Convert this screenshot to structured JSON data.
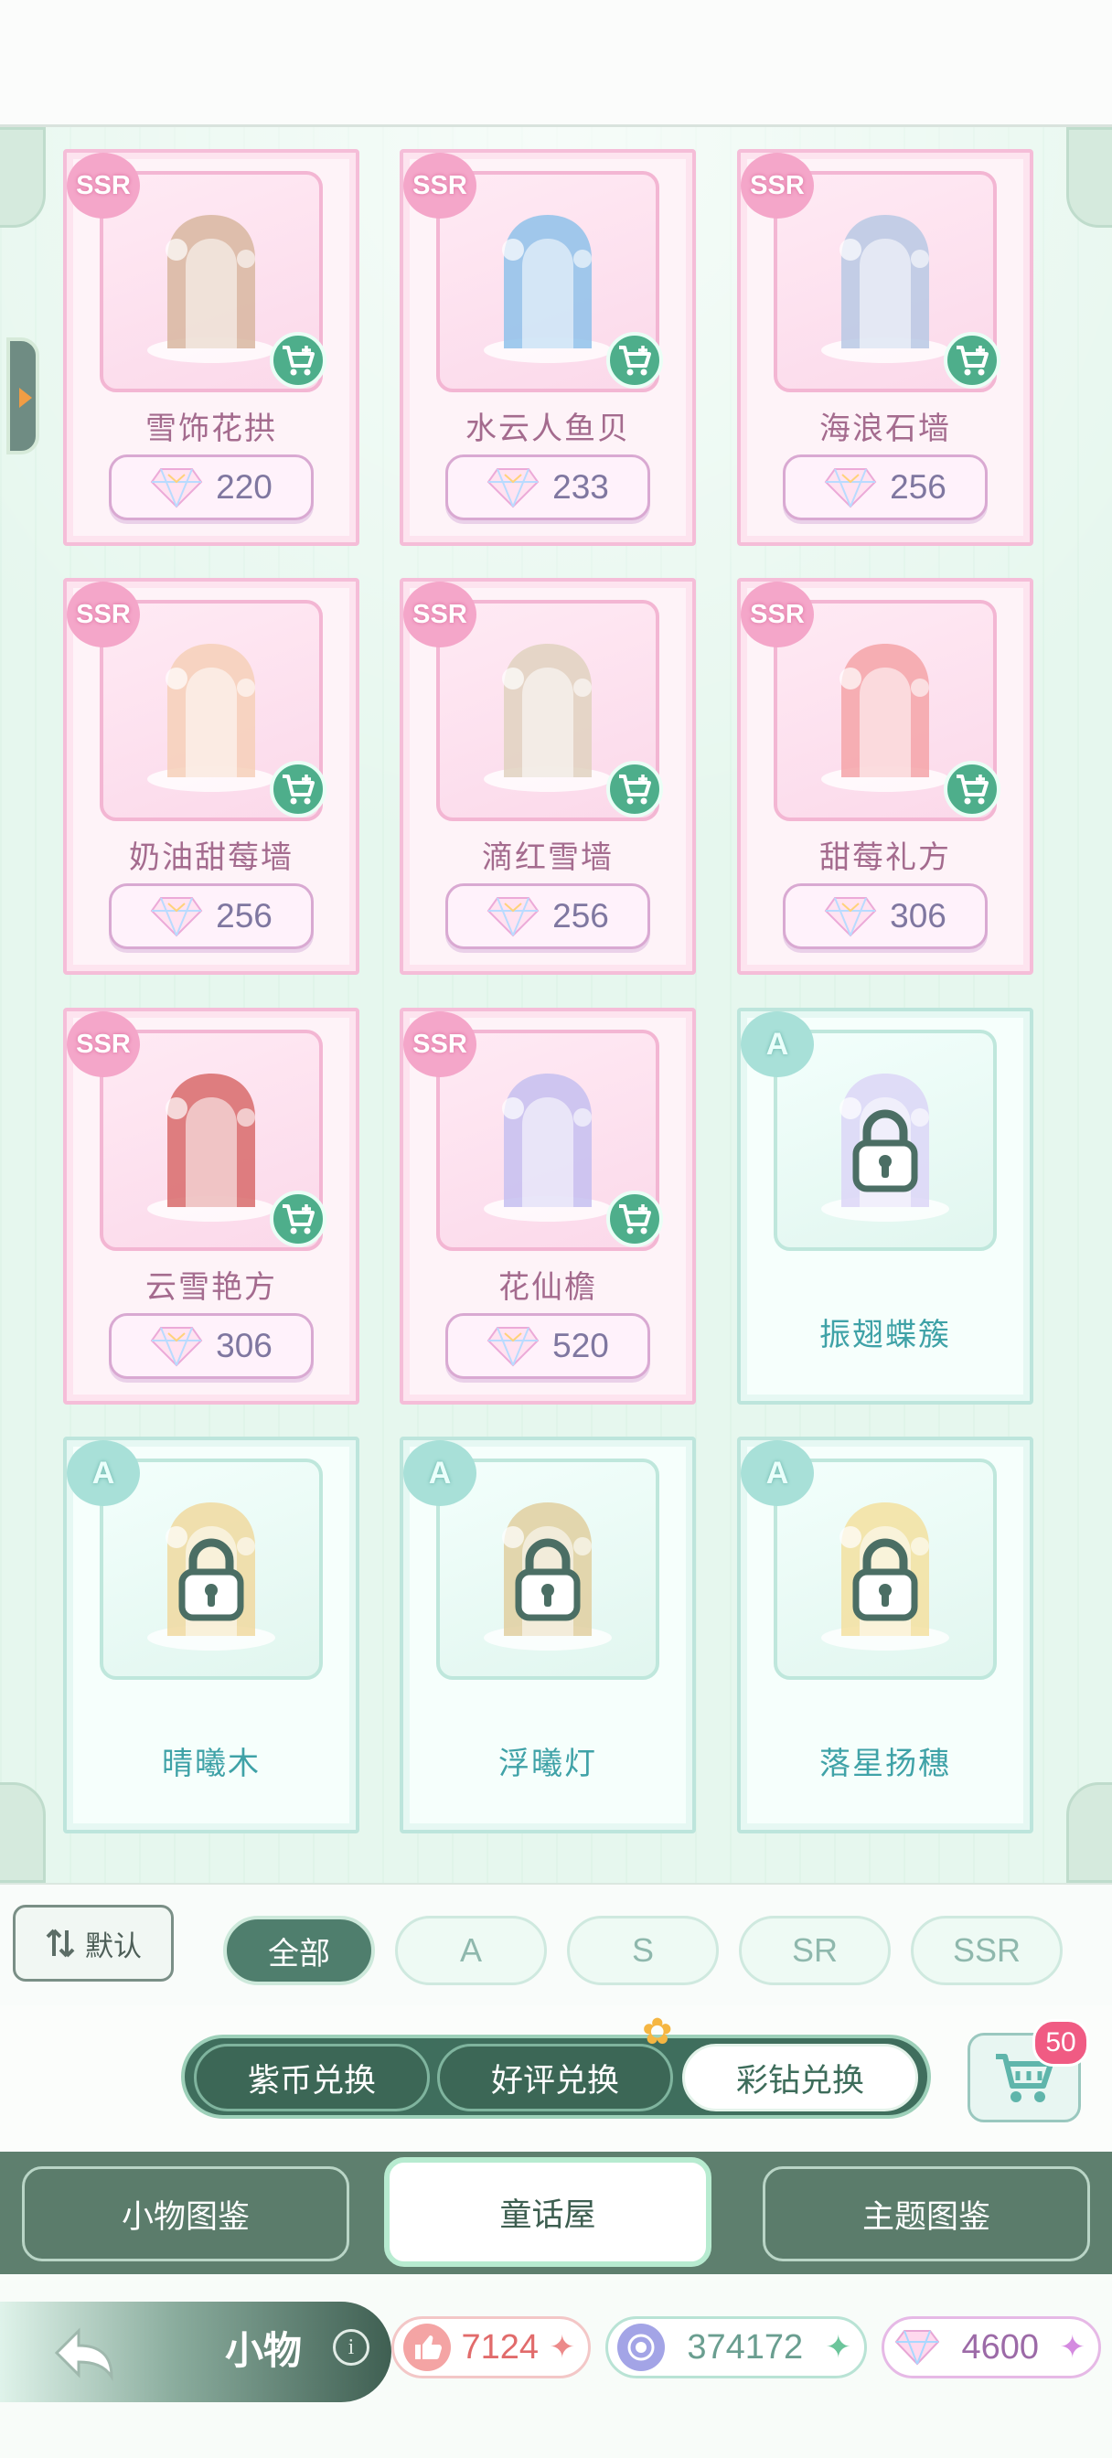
{
  "colors": {
    "ssr_name": "#a46b8e",
    "a_name": "#3fa2a7",
    "primary_green": "#4f7e6d",
    "price_text": "#7f77a0",
    "cart_badge": "#f05b83"
  },
  "items": [
    {
      "rarity": "SSR",
      "name": "雪饰花拱",
      "price": "220",
      "locked": false,
      "art": "snow-flower-arch"
    },
    {
      "rarity": "SSR",
      "name": "水云人鱼贝",
      "price": "233",
      "locked": false,
      "art": "water-cloud-mermaid-shell"
    },
    {
      "rarity": "SSR",
      "name": "海浪石墙",
      "price": "256",
      "locked": false,
      "art": "wave-stone-wall"
    },
    {
      "rarity": "SSR",
      "name": "奶油甜莓墙",
      "price": "256",
      "locked": false,
      "art": "cream-berry-wall"
    },
    {
      "rarity": "SSR",
      "name": "滴红雪墙",
      "price": "256",
      "locked": false,
      "art": "red-snow-wall"
    },
    {
      "rarity": "SSR",
      "name": "甜莓礼方",
      "price": "306",
      "locked": false,
      "art": "berry-gift-box"
    },
    {
      "rarity": "SSR",
      "name": "云雪艳方",
      "price": "306",
      "locked": false,
      "art": "cloud-snow-box"
    },
    {
      "rarity": "SSR",
      "name": "花仙檐",
      "price": "520",
      "locked": false,
      "art": "flower-fairy-eave"
    },
    {
      "rarity": "A",
      "name": "振翅蝶簇",
      "price": "",
      "locked": true,
      "art": "butterfly-cluster"
    },
    {
      "rarity": "A",
      "name": "晴曦木",
      "price": "",
      "locked": true,
      "art": "sunny-tree"
    },
    {
      "rarity": "A",
      "name": "浮曦灯",
      "price": "",
      "locked": true,
      "art": "floating-lamp"
    },
    {
      "rarity": "A",
      "name": "落星扬穗",
      "price": "",
      "locked": true,
      "art": "falling-star-tassel"
    }
  ],
  "filters": {
    "sort_label": "默认",
    "options": [
      "全部",
      "A",
      "S",
      "SR",
      "SSR"
    ],
    "active": "全部"
  },
  "exchange": {
    "tabs": [
      "紫币兑换",
      "好评兑换",
      "彩钻兑换"
    ],
    "active": "彩钻兑换",
    "cart_count": "50"
  },
  "nav": {
    "tabs": [
      "小物图鉴",
      "童话屋",
      "主题图鉴"
    ],
    "active": "童话屋"
  },
  "status": {
    "title": "小物",
    "info": "i",
    "currencies": [
      {
        "icon": "thumbs-up-icon",
        "amount": "7124"
      },
      {
        "icon": "purple-coin-icon",
        "amount": "374172"
      },
      {
        "icon": "diamond-icon",
        "amount": "4600"
      }
    ]
  }
}
